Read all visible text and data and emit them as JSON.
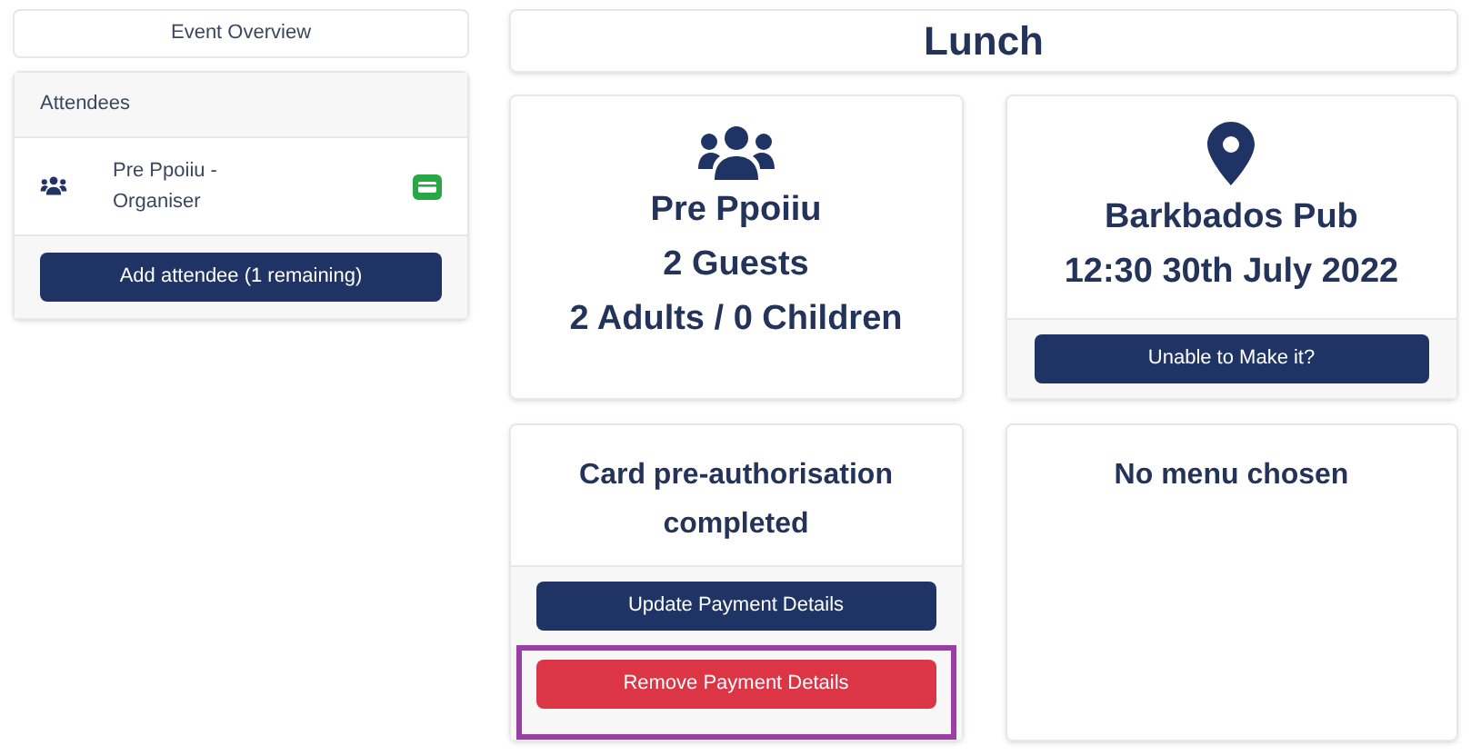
{
  "sidebar": {
    "overview_button": "Event Overview",
    "attendees": {
      "title": "Attendees",
      "items": [
        {
          "name": "Pre Ppoiiu - Organiser",
          "paid": true
        }
      ],
      "add_button": "Add attendee (1 remaining)"
    }
  },
  "event": {
    "title": "Lunch",
    "guest_card": {
      "lines": [
        "Pre Ppoiiu",
        "2 Guests",
        "2 Adults / 0 Children"
      ]
    },
    "venue_card": {
      "lines": [
        "Barkbados Pub",
        "12:30 30th July 2022"
      ],
      "button": "Unable to Make it?"
    },
    "payment_card": {
      "lines": [
        "Card pre-authorisation completed"
      ],
      "buttons": [
        {
          "label": "Update Payment Details",
          "kind": "primary",
          "highlighted": false
        },
        {
          "label": "Remove Payment Details",
          "kind": "danger",
          "highlighted": true
        }
      ]
    },
    "menu_card": {
      "lines": [
        "No menu chosen"
      ]
    }
  }
}
